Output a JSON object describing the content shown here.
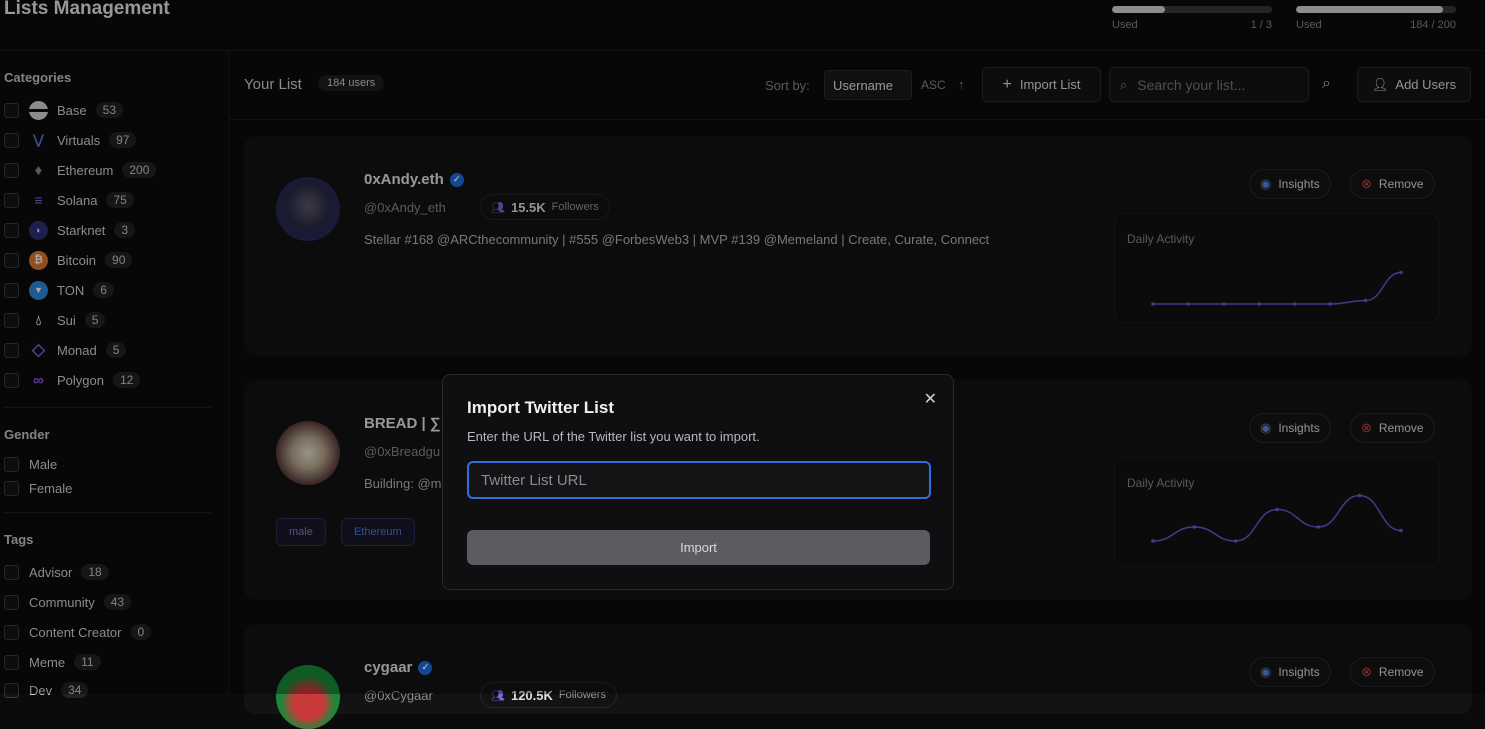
{
  "header": {
    "title": "Lists Management",
    "usage": [
      {
        "label": "Used",
        "count": "1 / 3",
        "fraction": 0.33
      },
      {
        "label": "Used",
        "count": "184 / 200",
        "fraction": 0.92
      }
    ]
  },
  "sidebar": {
    "categories_heading": "Categories",
    "categories": [
      {
        "label": "Base",
        "count": "53",
        "icon": "base-icon",
        "color": "#d8d8dc"
      },
      {
        "label": "Virtuals",
        "count": "97",
        "icon": "virtuals-icon",
        "color": "#5b7bd6"
      },
      {
        "label": "Ethereum",
        "count": "200",
        "icon": "ethereum-icon",
        "color": "#8a8a96"
      },
      {
        "label": "Solana",
        "count": "75",
        "icon": "solana-icon",
        "color": "#7d6bd8"
      },
      {
        "label": "Starknet",
        "count": "3",
        "icon": "starknet-icon",
        "color": "#3b3b8a"
      },
      {
        "label": "Bitcoin",
        "count": "90",
        "icon": "bitcoin-icon",
        "color": "#e07a2a"
      },
      {
        "label": "TON",
        "count": "6",
        "icon": "ton-icon",
        "color": "#2b8ae0"
      },
      {
        "label": "Sui",
        "count": "5",
        "icon": "sui-icon",
        "color": "#d8d8dc"
      },
      {
        "label": "Monad",
        "count": "5",
        "icon": "monad-icon",
        "color": "#7a5ae0"
      },
      {
        "label": "Polygon",
        "count": "12",
        "icon": "polygon-icon",
        "color": "#8a5ae0"
      }
    ],
    "gender_heading": "Gender",
    "genders": [
      "Male",
      "Female"
    ],
    "tags_heading": "Tags",
    "tags": [
      {
        "label": "Advisor",
        "count": "18"
      },
      {
        "label": "Community",
        "count": "43"
      },
      {
        "label": "Content Creator",
        "count": "0"
      },
      {
        "label": "Meme",
        "count": "11"
      },
      {
        "label": "Dev",
        "count": "34"
      }
    ]
  },
  "list_header": {
    "title": "Your List",
    "users_badge": "184 users",
    "sort_label": "Sort by:",
    "sort_value": "Username",
    "order": "ASC",
    "import_label": "Import List",
    "search_placeholder": "Search your list...",
    "add_users_label": "Add Users"
  },
  "cards": [
    {
      "name": "0xAndy.eth",
      "handle": "@0xAndy_eth",
      "followers_value": "15.5K",
      "followers_label": "Followers",
      "bio": "Stellar #168 @ARCthecommunity | #555 @ForbesWeb3 | MVP #139 @Memeland | Create, Curate, Connect",
      "insights_label": "Insights",
      "remove_label": "Remove",
      "activity_label": "Daily Activity",
      "activity": [
        0,
        0,
        0,
        0,
        0,
        0,
        0.05,
        0.45
      ]
    },
    {
      "name": "BREAD | ∑:",
      "handle": "@0xBreadgu",
      "bio": "Building: @m",
      "tags": [
        "male",
        "Ethereum"
      ],
      "insights_label": "Insights",
      "remove_label": "Remove",
      "activity_label": "Daily Activity",
      "activity": [
        0.1,
        0.3,
        0.1,
        0.55,
        0.3,
        0.75,
        0.25
      ]
    },
    {
      "name": "cygaar",
      "handle": "@0xCygaar",
      "followers_value": "120.5K",
      "followers_label": "Followers",
      "insights_label": "Insights",
      "remove_label": "Remove"
    }
  ],
  "modal": {
    "title": "Import Twitter List",
    "description": "Enter the URL of the Twitter list you want to import.",
    "input_placeholder": "Twitter List URL",
    "button_label": "Import"
  },
  "colors": {
    "accent": "#2f6fe0",
    "chart_line": "#6b5ad8",
    "remove_icon": "#d04848",
    "insights_icon": "#5b8ae0"
  }
}
